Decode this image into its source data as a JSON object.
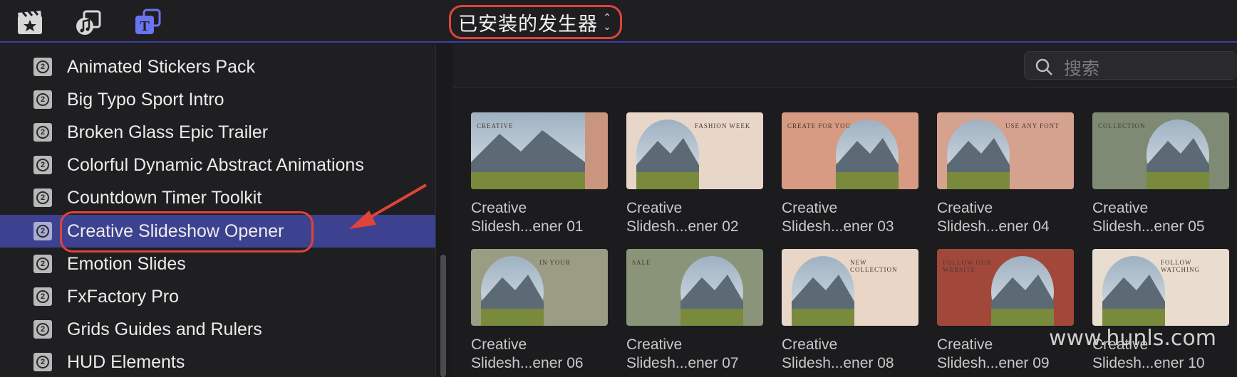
{
  "toolbar": {
    "icons": [
      "clapper-star-icon",
      "photos-music-icon",
      "titles-generators-icon"
    ],
    "browser_select": {
      "label": "已安装的发生器"
    }
  },
  "sidebar": {
    "items": [
      {
        "label": "Animated Stickers Pack"
      },
      {
        "label": "Big Typo Sport Intro"
      },
      {
        "label": "Broken Glass Epic Trailer"
      },
      {
        "label": "Colorful Dynamic Abstract Animations"
      },
      {
        "label": "Countdown Timer Toolkit"
      },
      {
        "label": "Creative Slideshow Opener",
        "selected": true
      },
      {
        "label": "Emotion Slides"
      },
      {
        "label": "FxFactory Pro"
      },
      {
        "label": "Grids Guides and Rulers"
      },
      {
        "label": "HUD Elements"
      }
    ],
    "package_glyph": "2"
  },
  "search": {
    "placeholder": "搜索"
  },
  "tiles": [
    {
      "line1": "Creative",
      "line2": "Slidesh...ener 01",
      "bg": "#c9957f",
      "text": "CREATIVE"
    },
    {
      "line1": "Creative",
      "line2": "Slidesh...ener 02",
      "bg": "#e8d6c9",
      "text": "FASHION WEEK"
    },
    {
      "line1": "Creative",
      "line2": "Slidesh...ener 03",
      "bg": "#d79a82",
      "text": "CREATE FOR YOU"
    },
    {
      "line1": "Creative",
      "line2": "Slidesh...ener 04",
      "bg": "#d6a290",
      "text": "USE ANY FONT"
    },
    {
      "line1": "Creative",
      "line2": "Slidesh...ener 05",
      "bg": "#7e8a74",
      "text": "COLLECTION"
    },
    {
      "line1": "Creative",
      "line2": "Slidesh...ener 06",
      "bg": "#9a9c84",
      "text": "IN YOUR"
    },
    {
      "line1": "Creative",
      "line2": "Slidesh...ener 07",
      "bg": "#8a9478",
      "text": "SALE"
    },
    {
      "line1": "Creative",
      "line2": "Slidesh...ener 08",
      "bg": "#ead6c6",
      "text": "NEW COLLECTION"
    },
    {
      "line1": "Creative",
      "line2": "Slidesh...ener 09",
      "bg": "#a2483a",
      "text": "FOLLOW OUR WEBSITE"
    },
    {
      "line1": "Creative",
      "line2": "Slidesh...ener 10",
      "bg": "#e9ddd0",
      "text": "FOLLOW WATCHING"
    }
  ],
  "watermark": "www.hunls.com"
}
